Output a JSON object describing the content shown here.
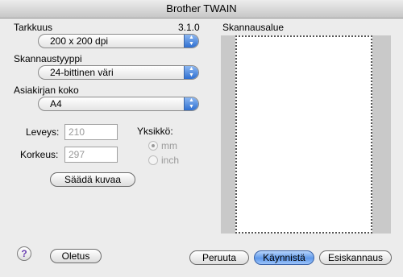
{
  "window": {
    "title": "Brother TWAIN"
  },
  "settings": {
    "resolution": {
      "label": "Tarkkuus",
      "value": "200 x 200 dpi"
    },
    "version": "3.1.0",
    "scan_type": {
      "label": "Skannaustyyppi",
      "value": "24-bittinen väri"
    },
    "document_size": {
      "label": "Asiakirjan koko",
      "value": "A4"
    },
    "width": {
      "label": "Leveys:",
      "value": "210"
    },
    "height": {
      "label": "Korkeus:",
      "value": "297"
    },
    "unit": {
      "label": "Yksikkö:",
      "options": [
        "mm",
        "inch"
      ],
      "selected": "mm"
    },
    "adjust_button": "Säädä kuvaa"
  },
  "scan_area": {
    "label": "Skannausalue"
  },
  "footer": {
    "help": "?",
    "default_button": "Oletus",
    "cancel_button": "Peruuta",
    "start_button": "Käynnistä",
    "prescan_button": "Esiskannaus"
  }
}
